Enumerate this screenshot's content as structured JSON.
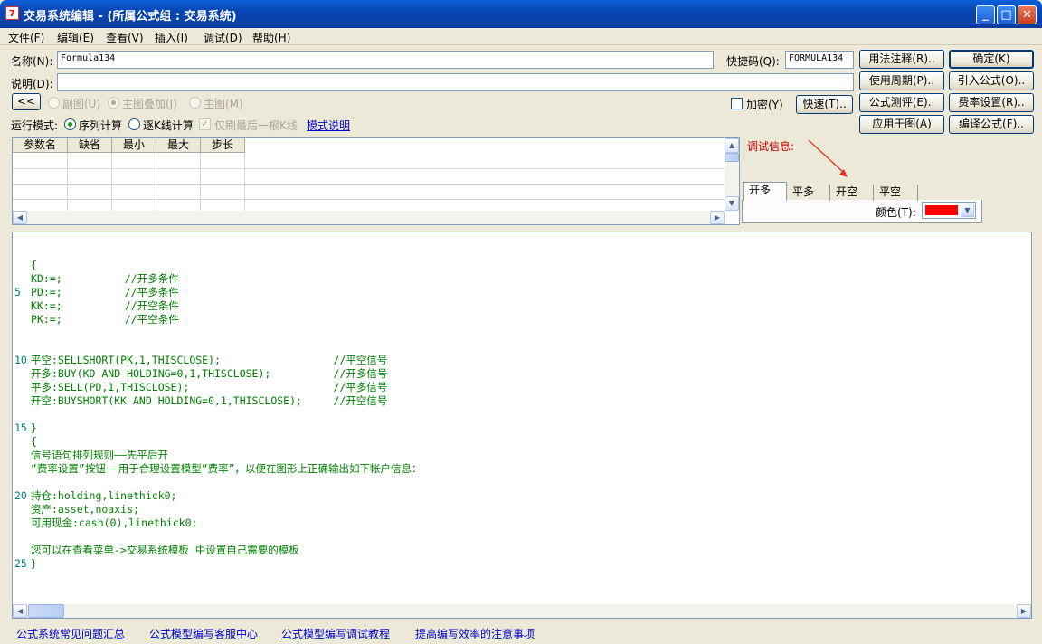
{
  "window": {
    "title": "交易系统编辑 - (所属公式组 : 交易系统)",
    "icon_text": "7"
  },
  "menu": [
    "文件(F)",
    "编辑(E)",
    "查看(V)",
    "插入(I)",
    "调试(D)",
    "帮助(H)"
  ],
  "name_label": "名称(N):",
  "name_value": "Formula134",
  "shortcut_label": "快捷码(Q):",
  "shortcut_value": "FORMULA134",
  "desc_label": "说明(D):",
  "desc_value": "",
  "buttons": {
    "usage_notes": "用法注释(R)..",
    "ok": "确定(K)",
    "period": "使用周期(P)..",
    "import": "引入公式(O)..",
    "evaluate": "公式测评(E)..",
    "fee": "费率设置(R)..",
    "apply": "应用于图(A)",
    "compile": "编译公式(F)..",
    "quick": "快速(T)..",
    "collapse": "<<"
  },
  "chart_options": {
    "sub": "副图(U)",
    "main_overlay": "主图叠加(J)",
    "main": "主图(M)"
  },
  "encrypt_label": "加密(Y)",
  "run_mode": {
    "label": "运行模式:",
    "sequence": "序列计算",
    "per_k": "逐K线计算",
    "refresh_last": "仅刷最后一根K线",
    "explain": "模式说明"
  },
  "params_headers": [
    "参数名",
    "缺省",
    "最小",
    "最大",
    "步长"
  ],
  "debug_label": "调试信息:",
  "tabs": [
    "开多",
    "平多",
    "开空",
    "平空"
  ],
  "color_label": "颜色(T):",
  "colors": {
    "selected": "#ff0000",
    "accent": "#cc0000"
  },
  "code_lines": [
    {
      "ln": "",
      "text": "{"
    },
    {
      "ln": "",
      "text": "KD:=;          //开多条件"
    },
    {
      "ln": "5",
      "text": "PD:=;          //平多条件"
    },
    {
      "ln": "",
      "text": "KK:=;          //开空条件"
    },
    {
      "ln": "",
      "text": "PK:=;          //平空条件"
    },
    {
      "ln": "",
      "text": ""
    },
    {
      "ln": "",
      "text": ""
    },
    {
      "ln": "10",
      "text": "平空:SELLSHORT(PK,1,THISCLOSE);                  //平空信号"
    },
    {
      "ln": "",
      "text": "开多:BUY(KD AND HOLDING=0,1,THISCLOSE);          //开多信号"
    },
    {
      "ln": "",
      "text": "平多:SELL(PD,1,THISCLOSE);                       //平多信号"
    },
    {
      "ln": "",
      "text": "开空:BUYSHORT(KK AND HOLDING=0,1,THISCLOSE);     //开空信号"
    },
    {
      "ln": "",
      "text": ""
    },
    {
      "ln": "15",
      "text": "}"
    },
    {
      "ln": "",
      "text": "{"
    },
    {
      "ln": "",
      "text": "信号语句排列规则——先平后开"
    },
    {
      "ln": "",
      "text": "“费率设置”按钮——用于合理设置模型“费率”，以便在图形上正确输出如下帐户信息："
    },
    {
      "ln": "",
      "text": ""
    },
    {
      "ln": "20",
      "text": "持仓:holding,linethick0;"
    },
    {
      "ln": "",
      "text": "资产:asset,noaxis;"
    },
    {
      "ln": "",
      "text": "可用现金:cash(0),linethick0;"
    },
    {
      "ln": "",
      "text": ""
    },
    {
      "ln": "",
      "text": "您可以在查看菜单->交易系统模板 中设置自己需要的模板"
    },
    {
      "ln": "25",
      "text": "}"
    }
  ],
  "footer_links": [
    "公式系统常见问题汇总",
    "公式模型编写客服中心",
    "公式模型编写调试教程",
    "提高编写效率的注意事项"
  ]
}
